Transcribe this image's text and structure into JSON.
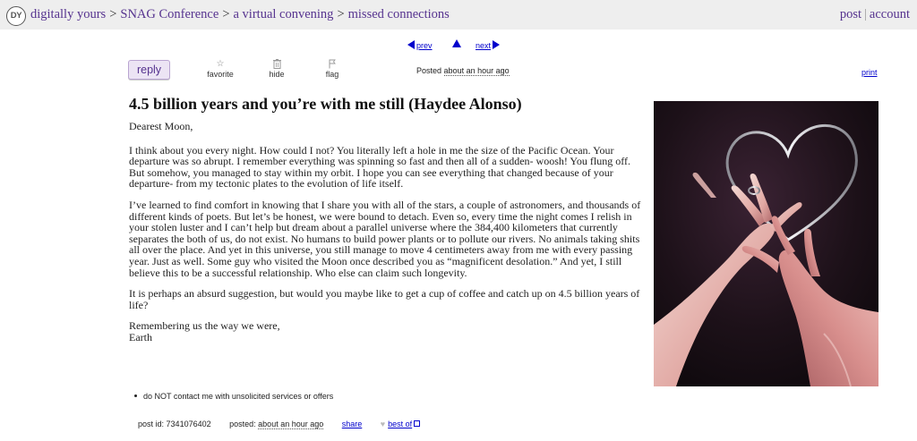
{
  "header": {
    "logo_text": "DY",
    "breadcrumbs": [
      "digitally yours",
      "SNAG Conference",
      "a virtual convening",
      "missed connections"
    ],
    "separator": ">",
    "post_link": "post",
    "divider": "|",
    "account_link": "account"
  },
  "pager": {
    "prev": "prev",
    "next": "next"
  },
  "actions": {
    "reply": "reply",
    "favorite": "favorite",
    "hide": "hide",
    "flag": "flag",
    "posted_label": "Posted",
    "posted_time": "about an hour ago",
    "print": "print"
  },
  "post": {
    "title": "4.5 billion years and you’re with me still (Haydee Alonso)",
    "greeting": "Dearest Moon,",
    "paragraphs": [
      "I think about you every night. How could I not? You literally left a hole in me the size of the Pacific Ocean. Your departure was so abrupt. I remember everything was spinning so fast and then all of a sudden- woosh! You flung off. But somehow, you managed to stay within my orbit. I hope you can see everything that changed because of your departure- from my tectonic plates to the evolution of life itself.",
      "I’ve learned to find comfort in knowing that I share you with all of the stars, a couple of astronomers, and thousands of different kinds of poets. But let’s be honest, we were bound to detach. Even so, every time the night comes I relish in your stolen luster and I can’t help but dream about a parallel universe where the 384,400 kilometers that currently separates the both of us, do not exist. No humans to build power plants or to pollute our rivers. No animals taking shits all over the place. And yet in this universe, you still manage to move 4 centimeters away from me with every passing year. Just as well. Some guy who visited the Moon once described you as “magnificent desolation.” And yet, I still believe this to be a successful relationship. Who else can claim such longevity.",
      "It is perhaps an absurd suggestion, but would you maybe like to get a cup of coffee and catch up on 4.5 billion years of life?"
    ],
    "closing": "Remembering us the way we were,",
    "signature": "Earth"
  },
  "notices": [
    "do NOT contact me with unsolicited services or offers"
  ],
  "footer": {
    "post_id_label": "post id:",
    "post_id": "7341076402",
    "posted_label": "posted:",
    "posted_time": "about an hour ago",
    "share": "share",
    "best_of": "best of"
  },
  "image": {
    "subject": "two-hands-holding-heart-wire-photo"
  },
  "colors": {
    "topbar": "#eeeeee",
    "link_purple": "#56338f",
    "link_blue": "#0000cc",
    "reply_bg": "#ece4f4"
  }
}
